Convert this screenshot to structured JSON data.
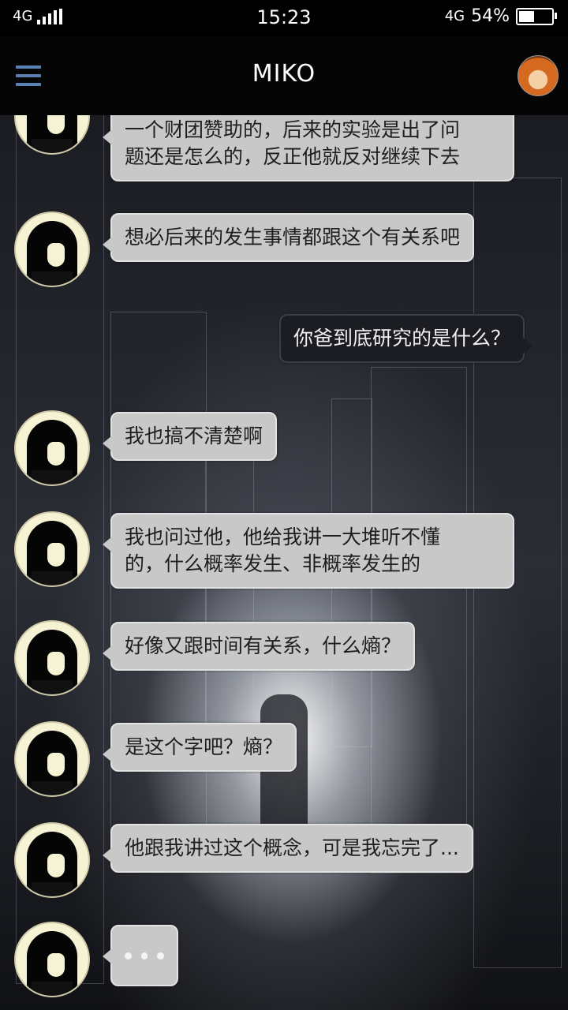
{
  "status_bar": {
    "network_left": "4G",
    "time": "15:23",
    "network_right": "4G",
    "battery": "54%",
    "battery_level": 0.54
  },
  "header": {
    "title": "MIKO"
  },
  "messages": [
    {
      "side": "left",
      "text": "一个财团赞助的，后来的实验是出了问\n题还是怎么的，反正他就反对继续下去"
    },
    {
      "side": "left",
      "text": "想必后来的发生事情都跟这个有关系吧"
    },
    {
      "side": "right",
      "text": "你爸到底研究的是什么？"
    },
    {
      "side": "left",
      "text": "我也搞不清楚啊"
    },
    {
      "side": "left",
      "text": "我也问过他，他给我讲一大堆听不懂\n的，什么概率发生、非概率发生的"
    },
    {
      "side": "left",
      "text": "好像又跟时间有关系，什么熵？"
    },
    {
      "side": "left",
      "text": "是这个字吧？熵？"
    },
    {
      "side": "left",
      "text": "他跟我讲过这个概念，可是我忘完了..."
    }
  ],
  "typing_indicator": "• • •"
}
